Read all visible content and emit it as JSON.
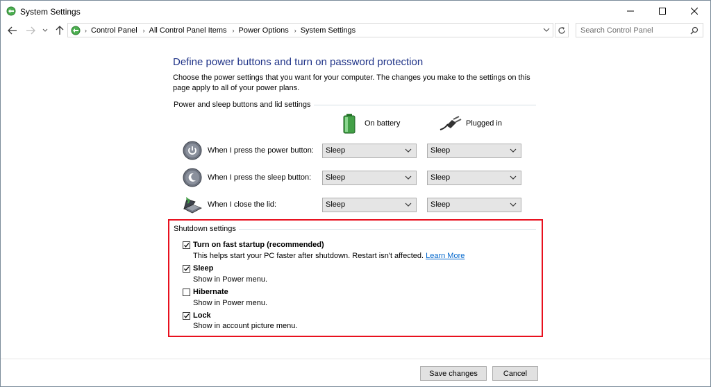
{
  "window": {
    "title": "System Settings"
  },
  "address": {
    "crumbs": [
      "Control Panel",
      "All Control Panel Items",
      "Power Options",
      "System Settings"
    ]
  },
  "search": {
    "placeholder": "Search Control Panel"
  },
  "page": {
    "heading": "Define power buttons and turn on password protection",
    "description": "Choose the power settings that you want for your computer. The changes you make to the settings on this page apply to all of your power plans."
  },
  "power_group": {
    "title": "Power and sleep buttons and lid settings",
    "col_battery": "On battery",
    "col_plugged": "Plugged in",
    "rows": [
      {
        "label": "When I press the power button:",
        "battery": "Sleep",
        "plugged": "Sleep"
      },
      {
        "label": "When I press the sleep button:",
        "battery": "Sleep",
        "plugged": "Sleep"
      },
      {
        "label": "When I close the lid:",
        "battery": "Sleep",
        "plugged": "Sleep"
      }
    ]
  },
  "shutdown": {
    "title": "Shutdown settings",
    "fast_startup": {
      "label": "Turn on fast startup (recommended)",
      "desc": "This helps start your PC faster after shutdown. Restart isn't affected.",
      "link": "Learn More",
      "checked": true
    },
    "sleep": {
      "label": "Sleep",
      "desc": "Show in Power menu.",
      "checked": true
    },
    "hibernate": {
      "label": "Hibernate",
      "desc": "Show in Power menu.",
      "checked": false
    },
    "lock": {
      "label": "Lock",
      "desc": "Show in account picture menu.",
      "checked": true
    }
  },
  "footer": {
    "save": "Save changes",
    "cancel": "Cancel"
  },
  "colors": {
    "heading": "#1e3287",
    "highlight": "#e8101e",
    "link": "#0066cc"
  }
}
